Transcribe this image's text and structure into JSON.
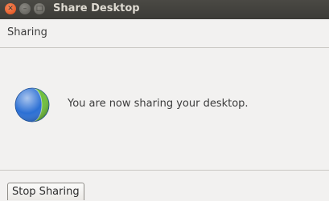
{
  "window": {
    "title": "Share Desktop"
  },
  "header": {
    "label": "Sharing"
  },
  "content": {
    "message": "You are now sharing your desktop.",
    "icon": "desktop-share-globe-icon"
  },
  "footer": {
    "stop_label": "Stop Sharing"
  },
  "colors": {
    "titlebar": "#3c3b37",
    "close_button": "#df4a16",
    "globe_blue": "#2b6fd4",
    "globe_green": "#6fbf3c"
  }
}
